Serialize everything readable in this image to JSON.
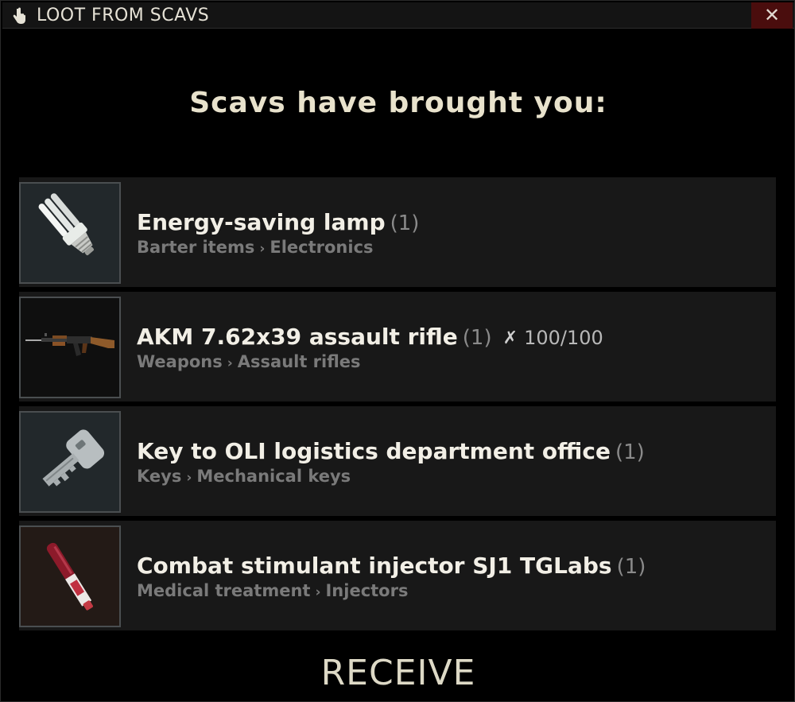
{
  "window": {
    "title": "LOOT FROM SCAVS",
    "close_symbol": "✕"
  },
  "heading": "Scavs have brought you:",
  "items": [
    {
      "name": "Energy-saving lamp",
      "count": "(1)",
      "category": "Barter items",
      "subcategory": "Electronics",
      "icon": "lamp-icon"
    },
    {
      "name": "AKM 7.62x39 assault rifle",
      "count": "(1)",
      "durability": "100/100",
      "category": "Weapons",
      "subcategory": "Assault rifles",
      "icon": "rifle-icon"
    },
    {
      "name": "Key to OLI logistics department office",
      "count": "(1)",
      "category": "Keys",
      "subcategory": "Mechanical keys",
      "icon": "key-icon"
    },
    {
      "name": "Combat stimulant injector SJ1 TGLabs",
      "count": "(1)",
      "category": "Medical treatment",
      "subcategory": "Injectors",
      "icon": "injector-icon"
    }
  ],
  "category_separator": "›",
  "receive_label": "RECEIVE",
  "colors": {
    "background": "#000000",
    "item_row": "#181818",
    "close_button": "#4a0d0d",
    "heading_text": "#e8e2cc",
    "category_text": "#7a7a7a"
  }
}
